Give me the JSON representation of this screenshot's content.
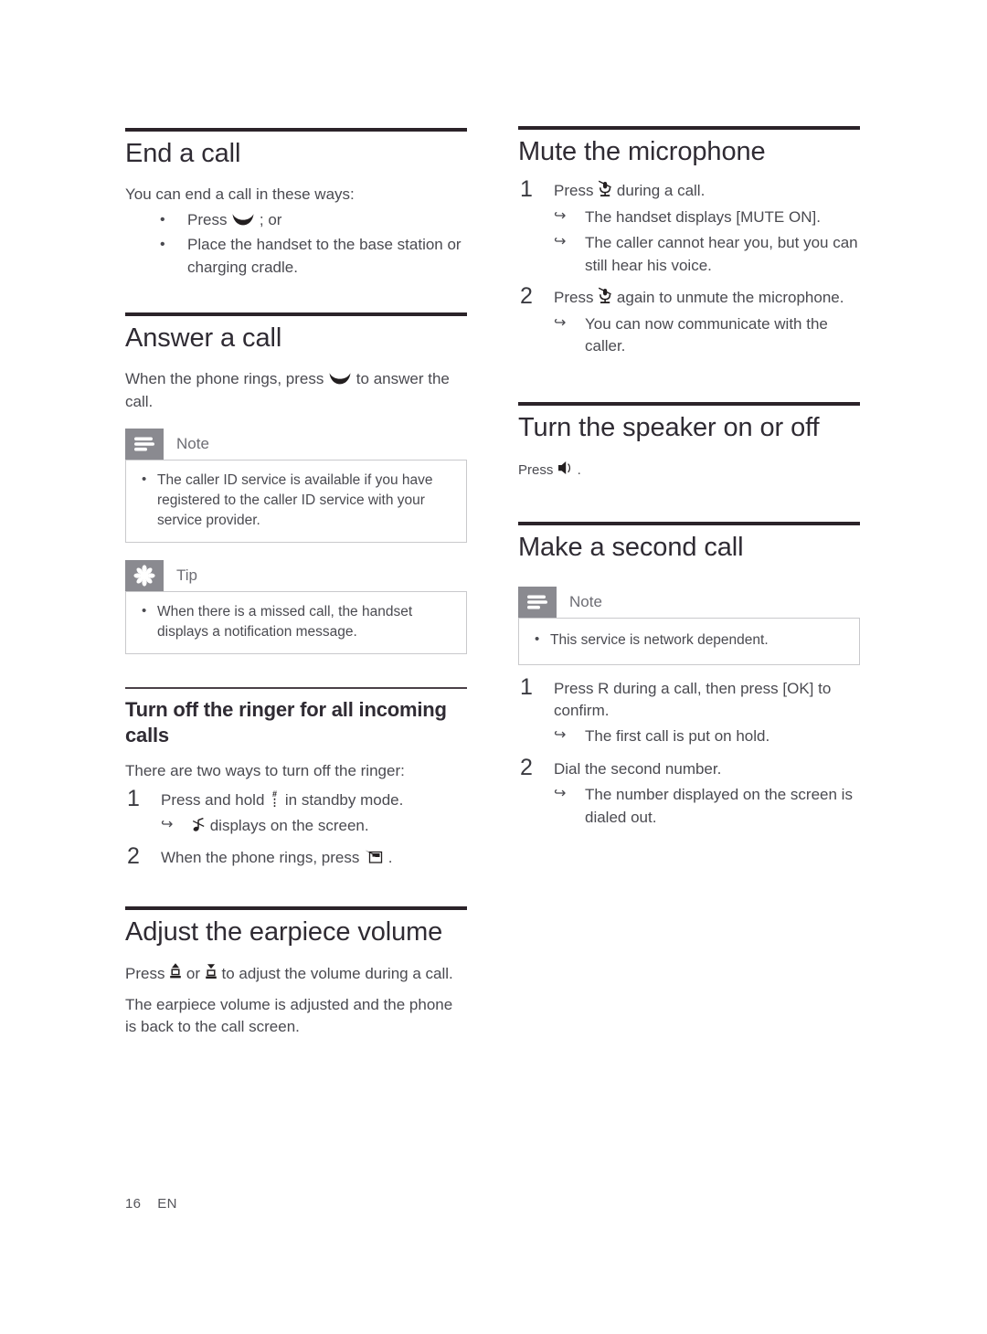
{
  "document": {
    "footer": {
      "page_number": "16",
      "language": "EN"
    }
  },
  "left_column": {
    "sections": [
      {
        "id": "end-a-call",
        "title": "End a call",
        "intro": "You can end a call in these ways:",
        "bullets": [
          {
            "pre": "Press ",
            "icon": "end-call-icon",
            "post": " ; or"
          },
          {
            "pre": "Place the handset to the base station or charging cradle.",
            "icon": null,
            "post": ""
          }
        ]
      },
      {
        "id": "answer-a-call",
        "title": "Answer a call",
        "paragraph_pre": "When the phone rings, press ",
        "paragraph_icon": "answer-call-icon",
        "paragraph_post": " to answer the call.",
        "note": {
          "label": "Note",
          "items": [
            "The caller ID service is available if you have registered to the caller ID service with your service provider."
          ]
        },
        "tip": {
          "label": "Tip",
          "items": [
            "When there is a missed call, the handset displays a notification message."
          ]
        },
        "subsection": {
          "title": "Turn off the ringer for all incoming calls",
          "intro": "There are two ways to turn off the ringer:",
          "steps": [
            {
              "number": "1",
              "pre": "Press and hold ",
              "icon": "hash-key-icon",
              "post": " in standby mode.",
              "results": [
                {
                  "pre": "",
                  "icon": "ringer-off-note-icon",
                  "post": " displays on the screen."
                }
              ]
            },
            {
              "number": "2",
              "pre": "When the phone rings, press ",
              "icon": "silence-softkey-icon",
              "post": " .",
              "results": []
            }
          ]
        }
      },
      {
        "id": "adjust-the-earpiece-volume",
        "title": "Adjust the earpiece volume",
        "paragraph1_pre": "Press ",
        "paragraph1_icon_up": "volume-up-key-icon",
        "paragraph1_mid": " or ",
        "paragraph1_icon_down": "volume-down-key-icon",
        "paragraph1_post": " to adjust the volume during a call.",
        "paragraph2": "The earpiece volume is adjusted and the phone is back to the call screen."
      }
    ]
  },
  "right_column": {
    "sections": [
      {
        "id": "mute-the-microphone",
        "title": "Mute the microphone",
        "steps": [
          {
            "number": "1",
            "pre": "Press ",
            "icon": "microphone-mute-icon",
            "post": " during a call.",
            "results": [
              {
                "text": "The handset displays [MUTE ON]."
              },
              {
                "text": "The caller cannot hear you, but you can still hear his voice."
              }
            ]
          },
          {
            "number": "2",
            "pre": "Press ",
            "icon": "microphone-mute-icon",
            "post": " again to unmute the microphone.",
            "results": [
              {
                "text": "You can now communicate with the caller."
              }
            ]
          }
        ]
      },
      {
        "id": "turn-the-speaker-on-or-off",
        "title": "Turn the speaker on or off",
        "paragraph_pre": "Press ",
        "paragraph_icon": "speaker-icon",
        "paragraph_post": " ."
      },
      {
        "id": "make-a-second-call",
        "title": "Make a second call",
        "note": {
          "label": "Note",
          "items": [
            "This service is network dependent."
          ]
        },
        "steps": [
          {
            "number": "1",
            "text": "Press R during a call, then press [OK] to confirm.",
            "results": [
              {
                "text": "The first call is put on hold."
              }
            ]
          },
          {
            "number": "2",
            "text": "Dial the second number.",
            "results": [
              {
                "text": "The number displayed on the screen is dialed out."
              }
            ]
          }
        ]
      }
    ]
  },
  "colors": {
    "rule": "#2b2329",
    "heading": "#2f2b33",
    "body_text": "#4a4a50",
    "callout_badge": "#8a8a90",
    "callout_border": "#c9c9cc"
  }
}
